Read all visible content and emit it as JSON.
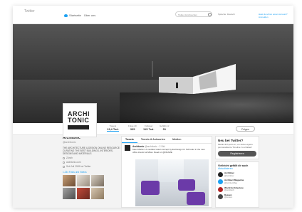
{
  "topnav": {
    "brand": "Twitter",
    "home": "Startseite",
    "notifications": "Über uns",
    "search_placeholder": "Twitter durchsuchen",
    "language": "Sprache: Deutsch",
    "login": "Hast du schon einen Account? Anmelden"
  },
  "profile": {
    "avatar_line1": "ARCHI",
    "avatar_line2": "TONIC",
    "name": "Architonic",
    "handle": "@architonic",
    "bio": "THE ARCHITECTURE & DESIGN ONLINE RESOURCE: CURATING THE BEST BUILDINGS, INTERIORS, DESIGNS AND MATERIALS",
    "location": "Zürich",
    "website": "architonic.com",
    "joined": "Seit Juli 2009 bei Twitter",
    "photos_label": "1.234 Fotos und Videos",
    "follow": "Folgen"
  },
  "stats": [
    {
      "label": "Tweets",
      "value": "13,4 Tsd."
    },
    {
      "label": "Folge ich",
      "value": "335"
    },
    {
      "label": "Follower",
      "value": "115 Tsd."
    },
    {
      "label": "Gefällt mir",
      "value": "51"
    }
  ],
  "tabs": [
    "Tweets",
    "Tweets & Antworten",
    "Medien"
  ],
  "tweet": {
    "author": "Architonic",
    "meta": "@architonic · 2 Std.",
    "text": "Meet Marker: A modular Hotel concept by Ea Design for Schroder in the new office interior at Milan. Read on @FRAME"
  },
  "signup_card": {
    "title": "Neu bei Twitter?",
    "text": "Melde dich jetzt an, um deine eigene personalisierte Timeline zu erhalten!",
    "button": "Registrieren"
  },
  "suggestions": {
    "title": "Vielleicht gefällt dir auch",
    "refresh": "Aktualisieren",
    "accounts": [
      {
        "name": "Architizer",
        "handle": "@Architizer",
        "color": "#222222"
      },
      {
        "name": "Architect Magazine",
        "handle": "@ArchitectMag",
        "color": "#1da1f2"
      },
      {
        "name": "World Architecture",
        "handle": "@worldarch",
        "color": "#b22222"
      },
      {
        "name": "Dezeen",
        "handle": "@dezeen",
        "color": "#444444"
      }
    ]
  },
  "colors": {
    "accent": "#1da1f2",
    "chair": "#6b3aa8"
  }
}
